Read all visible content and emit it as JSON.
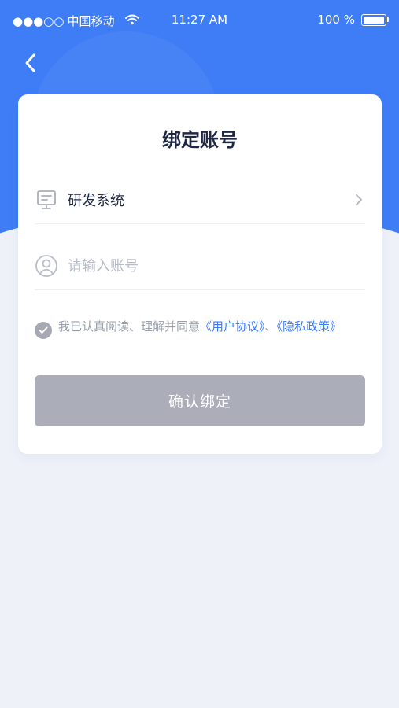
{
  "status_bar": {
    "signal": "●●●○○",
    "carrier": "中国移动",
    "time": "11:27 AM",
    "battery": "100 %"
  },
  "page": {
    "title": "绑定账号"
  },
  "form": {
    "system_label": "研发系统",
    "account_placeholder": "请输入账号",
    "account_value": ""
  },
  "agreement": {
    "checked": true,
    "prefix": "我已认真阅读、理解并同意",
    "user_agreement": "《用户协议》",
    "separator": "、",
    "privacy_policy": "《隐私政策》"
  },
  "actions": {
    "confirm_label": "确认绑定"
  },
  "icons": {
    "back": "chevron-left-icon",
    "system": "monitor-icon",
    "account": "user-circle-icon",
    "chevron": "chevron-right-icon",
    "check": "check-icon",
    "wifi": "wifi-icon",
    "battery": "battery-icon"
  },
  "colors": {
    "primary": "#3f7df6",
    "background": "#eef1f8",
    "link": "#3e7bf5",
    "button_disabled": "#abaeb9"
  }
}
